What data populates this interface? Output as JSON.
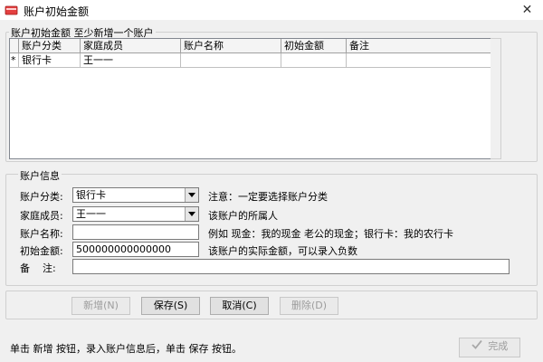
{
  "window": {
    "title": "账户初始金额",
    "close_glyph": "✕",
    "app_icon": "app-icon"
  },
  "grid_group": {
    "title": "账户初始金额 至少新增一个账户",
    "columns": [
      "账户分类",
      "家庭成员",
      "账户名称",
      "初始金额",
      "备注"
    ],
    "rows": [
      {
        "marker": "*",
        "cells": [
          "银行卡",
          "王一一",
          "",
          "",
          ""
        ]
      }
    ]
  },
  "form": {
    "title": "账户信息",
    "category": {
      "label": "账户分类:",
      "value": "银行卡",
      "hint": "注意：一定要选择账户分类"
    },
    "member": {
      "label": "家庭成员:",
      "value": "王一一",
      "hint": "该账户的所属人"
    },
    "name": {
      "label": "账户名称:",
      "value": "",
      "hint": "例如 现金：我的现金 老公的现金；银行卡：我的农行卡"
    },
    "amount": {
      "label": "初始金额:",
      "value": "500000000000000",
      "hint": "该账户的实际金额，可以录入负数"
    },
    "note": {
      "label": "备    注:",
      "value": ""
    }
  },
  "actions": {
    "add": {
      "label": "新增(N)",
      "enabled": false
    },
    "save": {
      "label": "保存(S)",
      "enabled": true
    },
    "cancel": {
      "label": "取消(C)",
      "enabled": true
    },
    "delete": {
      "label": "删除(D)",
      "enabled": false
    }
  },
  "status_text": "单击 新增 按钮，录入账户信息后，单击 保存 按钮。",
  "finish": {
    "label": "完成",
    "enabled": false,
    "icon": "check-icon"
  }
}
